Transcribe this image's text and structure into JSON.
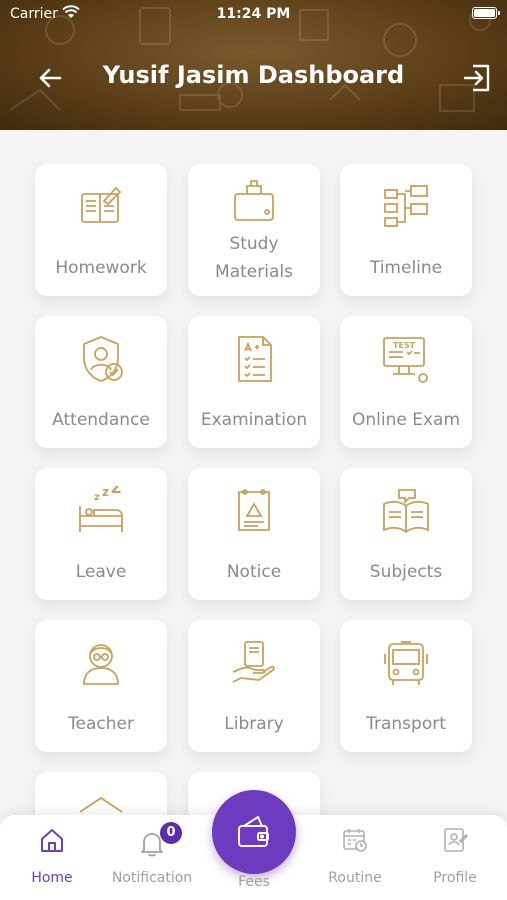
{
  "status_bar": {
    "carrier": "Carrier",
    "time": "11:24 PM"
  },
  "header": {
    "title": "Yusif Jasim Dashboard"
  },
  "colors": {
    "accent": "#6e3bc0",
    "icon_gold": "#c9a15a",
    "header_brown": "#5a3d17"
  },
  "menu": [
    {
      "label": "Homework",
      "icon": "homework-icon"
    },
    {
      "label": "Study Materials",
      "icon": "study-materials-icon"
    },
    {
      "label": "Timeline",
      "icon": "timeline-icon"
    },
    {
      "label": "Attendance",
      "icon": "attendance-icon"
    },
    {
      "label": "Examination",
      "icon": "examination-icon"
    },
    {
      "label": "Online Exam",
      "icon": "online-exam-icon"
    },
    {
      "label": "Leave",
      "icon": "leave-icon"
    },
    {
      "label": "Notice",
      "icon": "notice-icon"
    },
    {
      "label": "Subjects",
      "icon": "subjects-icon"
    },
    {
      "label": "Teacher",
      "icon": "teacher-icon"
    },
    {
      "label": "Library",
      "icon": "library-icon"
    },
    {
      "label": "Transport",
      "icon": "transport-icon"
    }
  ],
  "bottom_nav": {
    "home": "Home",
    "notification": "Notification",
    "notification_count": "0",
    "fees": "Fees",
    "routine": "Routine",
    "profile": "Profile"
  }
}
